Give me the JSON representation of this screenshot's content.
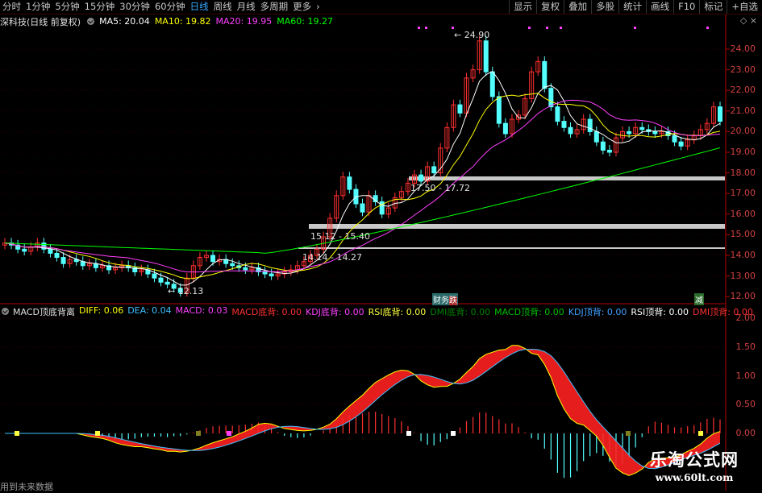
{
  "toolbar": {
    "periods": [
      "分时",
      "1分钟",
      "5分钟",
      "15分钟",
      "30分钟",
      "60分钟",
      "日线",
      "周线",
      "月线",
      "多周期",
      "更多"
    ],
    "active_period": "日线",
    "more_arrow": "›",
    "right_buttons": [
      "显示",
      "复权",
      "叠加",
      "多股",
      "统计",
      "画线",
      "F10",
      "标记",
      "+自选"
    ]
  },
  "header": {
    "stock_name": "深科技(日线 前复权)",
    "ma": [
      {
        "label": "MA5: 20.04",
        "color": "#ffffff"
      },
      {
        "label": "MA10: 19.82",
        "color": "#ffff00"
      },
      {
        "label": "MA20: 19.95",
        "color": "#ff40ff"
      },
      {
        "label": "MA60: 19.27",
        "color": "#00ff00"
      }
    ],
    "corner_icons": "◇ ×"
  },
  "price_axis": {
    "labels": [
      "24.00",
      "23.00",
      "22.00",
      "21.00",
      "20.00",
      "19.00",
      "18.00",
      "17.00",
      "16.00",
      "15.00",
      "14.00",
      "13.00",
      "12.00"
    ]
  },
  "annotations": {
    "high_label": "24.90",
    "low_label": "12.13",
    "zone1": "17.50 - 17.72",
    "zone2": "15.12 - 15.40",
    "zone3": "14.14 - 14.27",
    "signal_mid": "财务",
    "signal_mid2": "跌",
    "signal_right": "减"
  },
  "macd": {
    "title": "MACD顶底背离",
    "items": [
      {
        "label": "DIFF: 0.06",
        "color": "#ffff00"
      },
      {
        "label": "DEA: 0.04",
        "color": "#40c0ff"
      },
      {
        "label": "MACD: 0.03",
        "color": "#ff40ff"
      },
      {
        "label": "MACD底背: 0.00",
        "color": "#ff3030"
      },
      {
        "label": "KDJ底背: 0.00",
        "color": "#ff40ff"
      },
      {
        "label": "RSI底背: 0.00",
        "color": "#ffff40"
      },
      {
        "label": "DMI底背: 0.00",
        "color": "#008000"
      },
      {
        "label": "MACD顶背: 0.00",
        "color": "#00c000"
      },
      {
        "label": "KDJ顶背: 0.00",
        "color": "#40a0ff"
      },
      {
        "label": "RSI顶背: 0.00",
        "color": "#ffffff"
      },
      {
        "label": "DMI顶背: 0.00",
        "color": "#ff3030"
      }
    ],
    "axis": [
      "2.00",
      "1.50",
      "1.00",
      "0.50",
      "0.00"
    ]
  },
  "footer": {
    "text": "用到未来数据"
  },
  "watermark": {
    "line1": "乐淘公式网",
    "line2": "www.60lt.com"
  },
  "colors": {
    "up": "#ff3030",
    "down": "#54ffff",
    "grid": "#800000"
  }
}
